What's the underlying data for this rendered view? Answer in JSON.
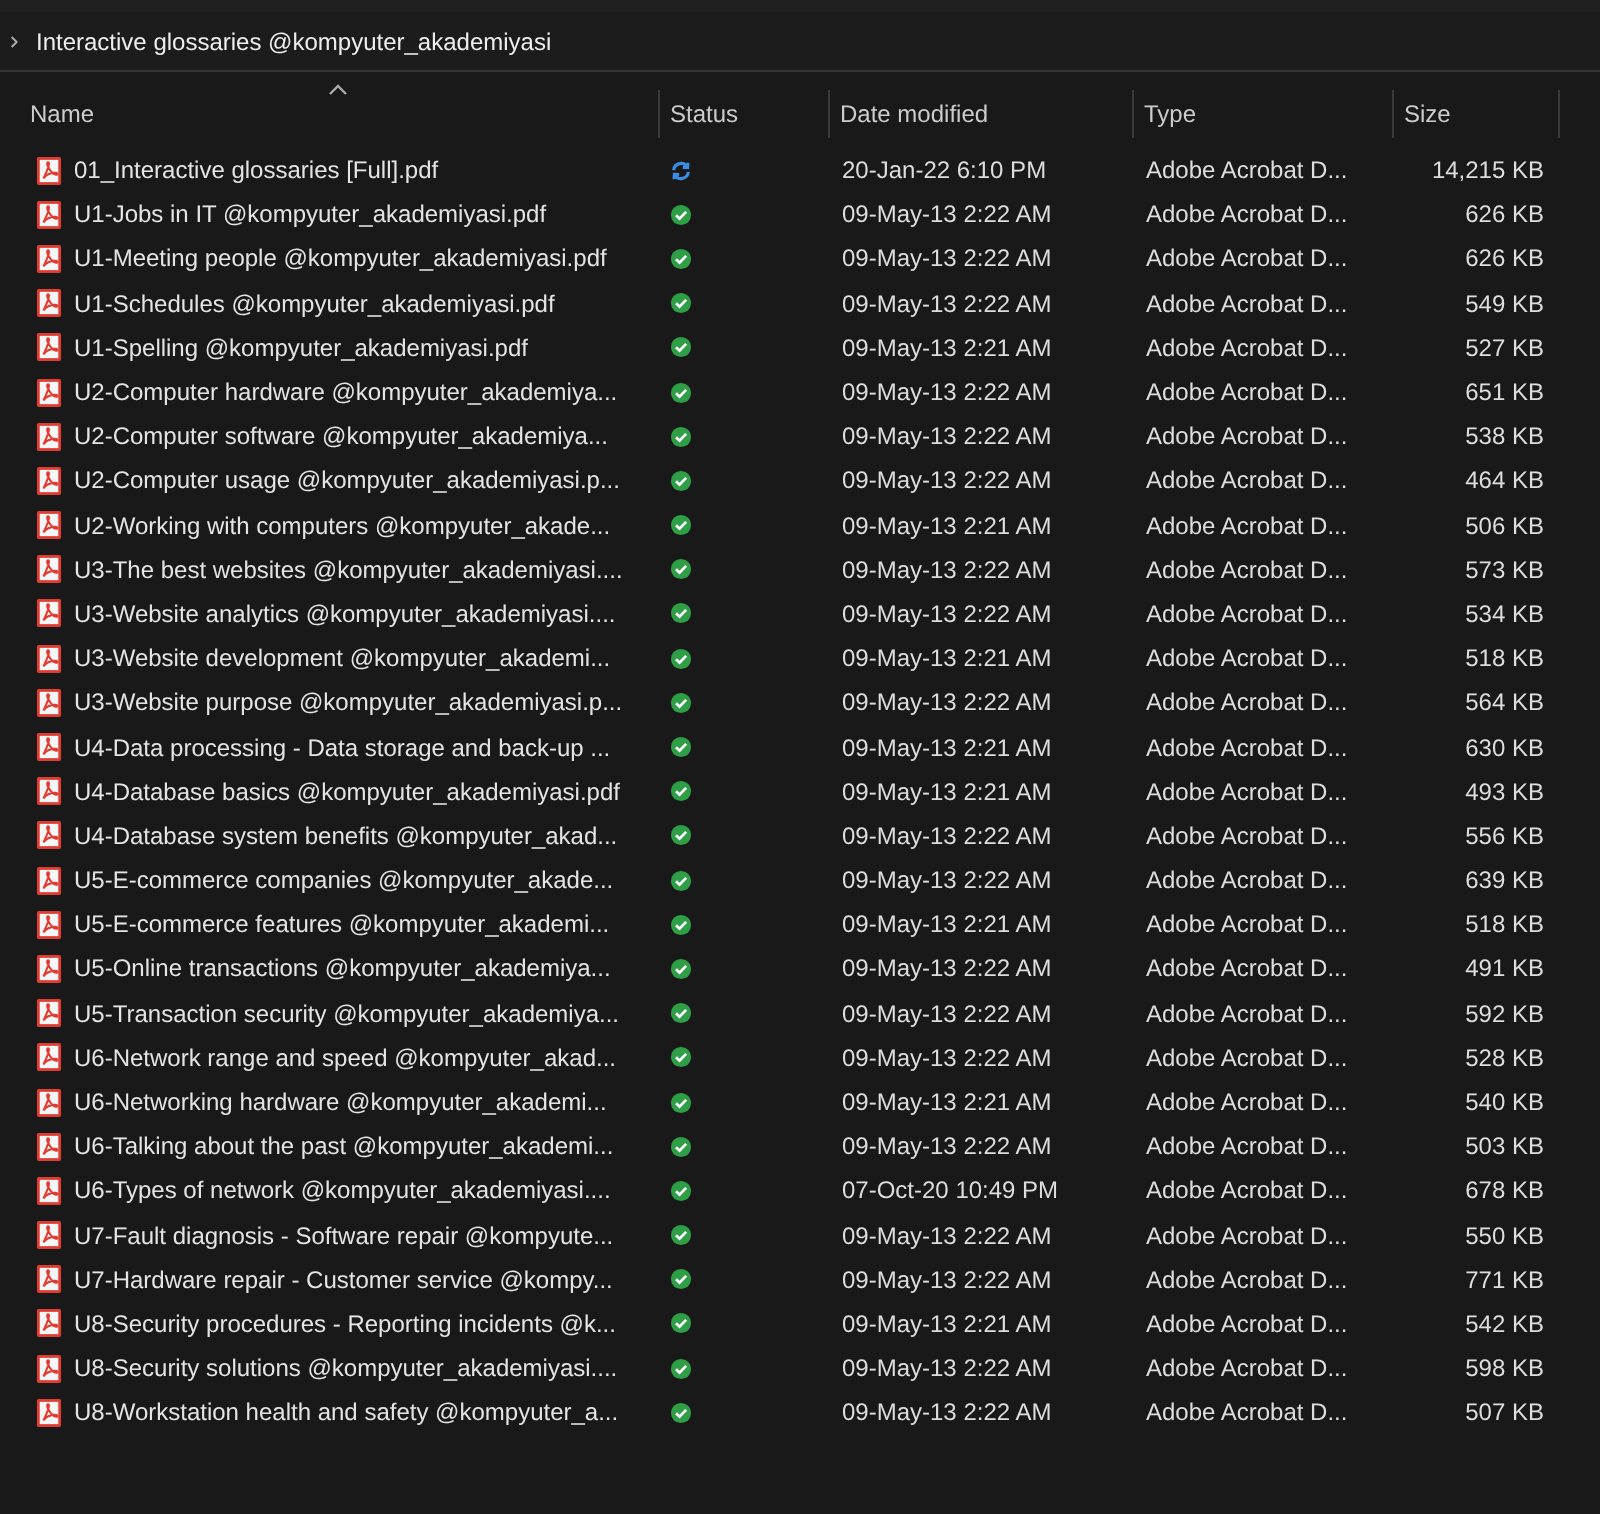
{
  "breadcrumb": {
    "path": "Interactive glossaries @kompyuter_akademiyasi"
  },
  "table": {
    "columns": [
      "Name",
      "Status",
      "Date modified",
      "Type",
      "Size"
    ],
    "rows": [
      {
        "name": "01_Interactive glossaries [Full].pdf",
        "synced": false,
        "date": "20-Jan-22 6:10 PM",
        "type": "Adobe Acrobat D...",
        "size": "14,215 KB"
      },
      {
        "name": "U1-Jobs in IT @kompyuter_akademiyasi.pdf",
        "synced": true,
        "date": "09-May-13 2:22 AM",
        "type": "Adobe Acrobat D...",
        "size": "626 KB"
      },
      {
        "name": "U1-Meeting people @kompyuter_akademiyasi.pdf",
        "synced": true,
        "date": "09-May-13 2:22 AM",
        "type": "Adobe Acrobat D...",
        "size": "626 KB"
      },
      {
        "name": "U1-Schedules @kompyuter_akademiyasi.pdf",
        "synced": true,
        "date": "09-May-13 2:22 AM",
        "type": "Adobe Acrobat D...",
        "size": "549 KB"
      },
      {
        "name": "U1-Spelling @kompyuter_akademiyasi.pdf",
        "synced": true,
        "date": "09-May-13 2:21 AM",
        "type": "Adobe Acrobat D...",
        "size": "527 KB"
      },
      {
        "name": "U2-Computer hardware @kompyuter_akademiya...",
        "synced": true,
        "date": "09-May-13 2:22 AM",
        "type": "Adobe Acrobat D...",
        "size": "651 KB"
      },
      {
        "name": "U2-Computer software @kompyuter_akademiya...",
        "synced": true,
        "date": "09-May-13 2:22 AM",
        "type": "Adobe Acrobat D...",
        "size": "538 KB"
      },
      {
        "name": "U2-Computer usage @kompyuter_akademiyasi.p...",
        "synced": true,
        "date": "09-May-13 2:22 AM",
        "type": "Adobe Acrobat D...",
        "size": "464 KB"
      },
      {
        "name": "U2-Working with computers @kompyuter_akade...",
        "synced": true,
        "date": "09-May-13 2:21 AM",
        "type": "Adobe Acrobat D...",
        "size": "506 KB"
      },
      {
        "name": "U3-The best websites @kompyuter_akademiyasi....",
        "synced": true,
        "date": "09-May-13 2:22 AM",
        "type": "Adobe Acrobat D...",
        "size": "573 KB"
      },
      {
        "name": "U3-Website analytics @kompyuter_akademiyasi....",
        "synced": true,
        "date": "09-May-13 2:22 AM",
        "type": "Adobe Acrobat D...",
        "size": "534 KB"
      },
      {
        "name": "U3-Website development @kompyuter_akademi...",
        "synced": true,
        "date": "09-May-13 2:21 AM",
        "type": "Adobe Acrobat D...",
        "size": "518 KB"
      },
      {
        "name": "U3-Website purpose @kompyuter_akademiyasi.p...",
        "synced": true,
        "date": "09-May-13 2:22 AM",
        "type": "Adobe Acrobat D...",
        "size": "564 KB"
      },
      {
        "name": "U4-Data processing - Data storage and back-up ...",
        "synced": true,
        "date": "09-May-13 2:21 AM",
        "type": "Adobe Acrobat D...",
        "size": "630 KB"
      },
      {
        "name": "U4-Database basics @kompyuter_akademiyasi.pdf",
        "synced": true,
        "date": "09-May-13 2:21 AM",
        "type": "Adobe Acrobat D...",
        "size": "493 KB"
      },
      {
        "name": "U4-Database system benefits @kompyuter_akad...",
        "synced": true,
        "date": "09-May-13 2:22 AM",
        "type": "Adobe Acrobat D...",
        "size": "556 KB"
      },
      {
        "name": "U5-E-commerce companies @kompyuter_akade...",
        "synced": true,
        "date": "09-May-13 2:22 AM",
        "type": "Adobe Acrobat D...",
        "size": "639 KB"
      },
      {
        "name": "U5-E-commerce features @kompyuter_akademi...",
        "synced": true,
        "date": "09-May-13 2:21 AM",
        "type": "Adobe Acrobat D...",
        "size": "518 KB"
      },
      {
        "name": "U5-Online transactions @kompyuter_akademiya...",
        "synced": true,
        "date": "09-May-13 2:22 AM",
        "type": "Adobe Acrobat D...",
        "size": "491 KB"
      },
      {
        "name": "U5-Transaction security @kompyuter_akademiya...",
        "synced": true,
        "date": "09-May-13 2:22 AM",
        "type": "Adobe Acrobat D...",
        "size": "592 KB"
      },
      {
        "name": "U6-Network range and speed @kompyuter_akad...",
        "synced": true,
        "date": "09-May-13 2:22 AM",
        "type": "Adobe Acrobat D...",
        "size": "528 KB"
      },
      {
        "name": "U6-Networking hardware @kompyuter_akademi...",
        "synced": true,
        "date": "09-May-13 2:21 AM",
        "type": "Adobe Acrobat D...",
        "size": "540 KB"
      },
      {
        "name": "U6-Talking about the past @kompyuter_akademi...",
        "synced": true,
        "date": "09-May-13 2:22 AM",
        "type": "Adobe Acrobat D...",
        "size": "503 KB"
      },
      {
        "name": "U6-Types of network @kompyuter_akademiyasi....",
        "synced": true,
        "date": "07-Oct-20 10:49 PM",
        "type": "Adobe Acrobat D...",
        "size": "678 KB"
      },
      {
        "name": "U7-Fault diagnosis - Software repair @kompyute...",
        "synced": true,
        "date": "09-May-13 2:22 AM",
        "type": "Adobe Acrobat D...",
        "size": "550 KB"
      },
      {
        "name": "U7-Hardware repair - Customer service @kompy...",
        "synced": true,
        "date": "09-May-13 2:22 AM",
        "type": "Adobe Acrobat D...",
        "size": "771 KB"
      },
      {
        "name": "U8-Security procedures - Reporting incidents @k...",
        "synced": true,
        "date": "09-May-13 2:21 AM",
        "type": "Adobe Acrobat D...",
        "size": "542 KB"
      },
      {
        "name": "U8-Security solutions @kompyuter_akademiyasi....",
        "synced": true,
        "date": "09-May-13 2:22 AM",
        "type": "Adobe Acrobat D...",
        "size": "598 KB"
      },
      {
        "name": "U8-Workstation health and safety @kompyuter_a...",
        "synced": true,
        "date": "09-May-13 2:22 AM",
        "type": "Adobe Acrobat D...",
        "size": "507 KB"
      }
    ]
  }
}
